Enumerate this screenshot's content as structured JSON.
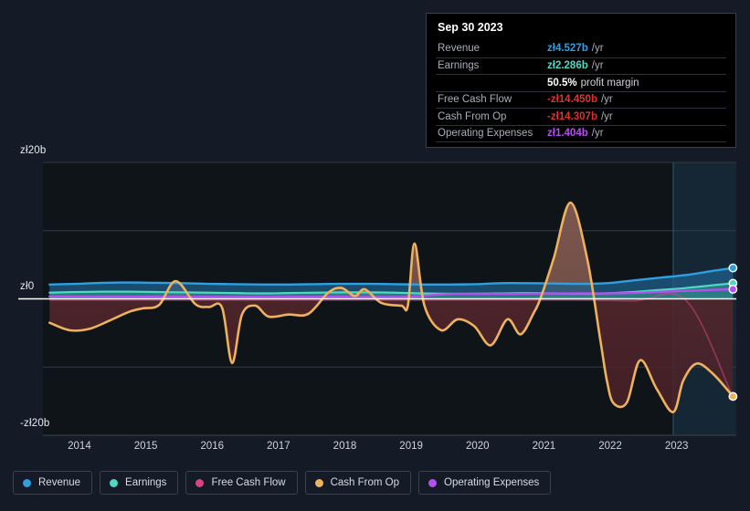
{
  "currency_symbol": "zł",
  "axis": {
    "y_top_label": "zł20b",
    "y_zero_label": "zł0",
    "y_bottom_label": "-zł20b",
    "x_labels": [
      "2014",
      "2015",
      "2016",
      "2017",
      "2018",
      "2019",
      "2020",
      "2021",
      "2022",
      "2023"
    ]
  },
  "tooltip": {
    "date": "Sep 30 2023",
    "rows": [
      {
        "label": "Revenue",
        "value": "zł4.527b",
        "unit": "/yr",
        "color": "#2f9fe3"
      },
      {
        "label": "Earnings",
        "value": "zł2.286b",
        "unit": "/yr",
        "color": "#4fd8c2"
      },
      {
        "label": "",
        "value": "50.5%",
        "sub": "profit margin",
        "color": "#ffffff"
      },
      {
        "label": "Free Cash Flow",
        "value": "-zł14.450b",
        "unit": "/yr",
        "color": "#e03131"
      },
      {
        "label": "Cash From Op",
        "value": "-zł14.307b",
        "unit": "/yr",
        "color": "#e03131"
      },
      {
        "label": "Operating Expenses",
        "value": "zł1.404b",
        "unit": "/yr",
        "color": "#b44ff0"
      }
    ]
  },
  "legend": {
    "items": [
      {
        "label": "Revenue",
        "color": "#2f9fe3"
      },
      {
        "label": "Earnings",
        "color": "#4fd8c2"
      },
      {
        "label": "Free Cash Flow",
        "color": "#d6457f"
      },
      {
        "label": "Cash From Op",
        "color": "#eeb15c"
      },
      {
        "label": "Operating Expenses",
        "color": "#b44ff0"
      }
    ]
  },
  "chart_data": {
    "type": "line",
    "title": "",
    "xlabel": "",
    "ylabel": "zł (billions per year)",
    "ylim": [
      -20,
      20
    ],
    "xlim": [
      2013.5,
      2023.95
    ],
    "grid": true,
    "gridlines_y": [
      20,
      10,
      0,
      -10,
      -20
    ],
    "zero_line": 0,
    "legend_position": "bottom-left",
    "forecast_start_x": 2023.0,
    "series": [
      {
        "name": "Revenue",
        "color": "#2f9fe3",
        "x": [
          2013.6,
          2014.0,
          2014.4,
          2014.8,
          2015.2,
          2015.6,
          2016.0,
          2016.4,
          2016.8,
          2017.2,
          2017.6,
          2018.0,
          2018.4,
          2018.8,
          2019.2,
          2019.6,
          2020.0,
          2020.4,
          2020.8,
          2021.2,
          2021.6,
          2022.0,
          2022.4,
          2022.8,
          2023.2,
          2023.6,
          2023.9
        ],
        "values": [
          2.1,
          2.2,
          2.35,
          2.4,
          2.35,
          2.3,
          2.2,
          2.15,
          2.1,
          2.1,
          2.15,
          2.2,
          2.2,
          2.15,
          2.1,
          2.1,
          2.15,
          2.3,
          2.3,
          2.25,
          2.2,
          2.3,
          2.7,
          3.1,
          3.5,
          4.1,
          4.527
        ]
      },
      {
        "name": "Earnings",
        "color": "#4fd8c2",
        "x": [
          2013.6,
          2014.0,
          2014.4,
          2014.8,
          2015.2,
          2015.6,
          2016.0,
          2016.4,
          2016.8,
          2017.2,
          2017.6,
          2018.0,
          2018.4,
          2018.8,
          2019.2,
          2019.6,
          2020.0,
          2020.4,
          2020.8,
          2021.2,
          2021.6,
          2022.0,
          2022.4,
          2022.8,
          2023.2,
          2023.6,
          2023.9
        ],
        "values": [
          0.9,
          1.0,
          1.05,
          1.05,
          1.0,
          0.95,
          0.9,
          0.85,
          0.8,
          0.85,
          0.9,
          0.95,
          0.95,
          0.9,
          0.8,
          0.75,
          0.75,
          0.8,
          0.85,
          0.8,
          0.75,
          0.8,
          1.0,
          1.3,
          1.6,
          2.0,
          2.286
        ]
      },
      {
        "name": "Free Cash Flow",
        "color": "#d6457f",
        "x": [
          2013.6,
          2016.0,
          2018.0,
          2020.0,
          2021.6,
          2022.4,
          2023.2,
          2023.9
        ],
        "values": [
          -0.2,
          -0.2,
          -0.2,
          -0.2,
          -0.2,
          -0.3,
          -0.3,
          -14.45
        ],
        "note": "hidden beneath Cash From Op for most of range"
      },
      {
        "name": "Cash From Op",
        "color": "#eeb15c",
        "x": [
          2013.6,
          2013.9,
          2014.2,
          2014.5,
          2014.8,
          2015.0,
          2015.25,
          2015.5,
          2015.8,
          2016.0,
          2016.2,
          2016.35,
          2016.5,
          2016.7,
          2016.9,
          2017.2,
          2017.5,
          2017.8,
          2018.0,
          2018.2,
          2018.35,
          2018.6,
          2018.9,
          2019.0,
          2019.1,
          2019.25,
          2019.5,
          2019.75,
          2020.0,
          2020.25,
          2020.5,
          2020.7,
          2020.9,
          2021.0,
          2021.2,
          2021.45,
          2021.7,
          2021.9,
          2022.0,
          2022.1,
          2022.3,
          2022.5,
          2022.75,
          2023.0,
          2023.15,
          2023.35,
          2023.6,
          2023.9
        ],
        "values": [
          -3.5,
          -4.6,
          -4.4,
          -3.2,
          -1.9,
          -1.4,
          -0.9,
          2.6,
          -0.8,
          -1.2,
          -1.3,
          -9.4,
          -2.3,
          -1.0,
          -2.6,
          -2.3,
          -2.2,
          0.9,
          1.6,
          0.4,
          1.4,
          -0.6,
          -1.0,
          -1.0,
          8.1,
          -1.0,
          -4.6,
          -3.0,
          -4.0,
          -6.8,
          -3.0,
          -5.2,
          -2.0,
          0.1,
          6.0,
          14.1,
          6.0,
          -6.0,
          -12.0,
          -15.3,
          -15.2,
          -9.0,
          -13.2,
          -16.6,
          -12.0,
          -9.5,
          -11.0,
          -14.307
        ]
      },
      {
        "name": "Operating Expenses",
        "color": "#b44ff0",
        "x": [
          2013.6,
          2016.0,
          2018.0,
          2019.0,
          2019.6,
          2020.5,
          2021.5,
          2022.0,
          2022.5,
          2023.0,
          2023.9
        ],
        "values": [
          0.35,
          0.3,
          0.3,
          0.3,
          0.7,
          0.75,
          0.8,
          0.8,
          0.9,
          1.1,
          1.404
        ]
      }
    ]
  }
}
